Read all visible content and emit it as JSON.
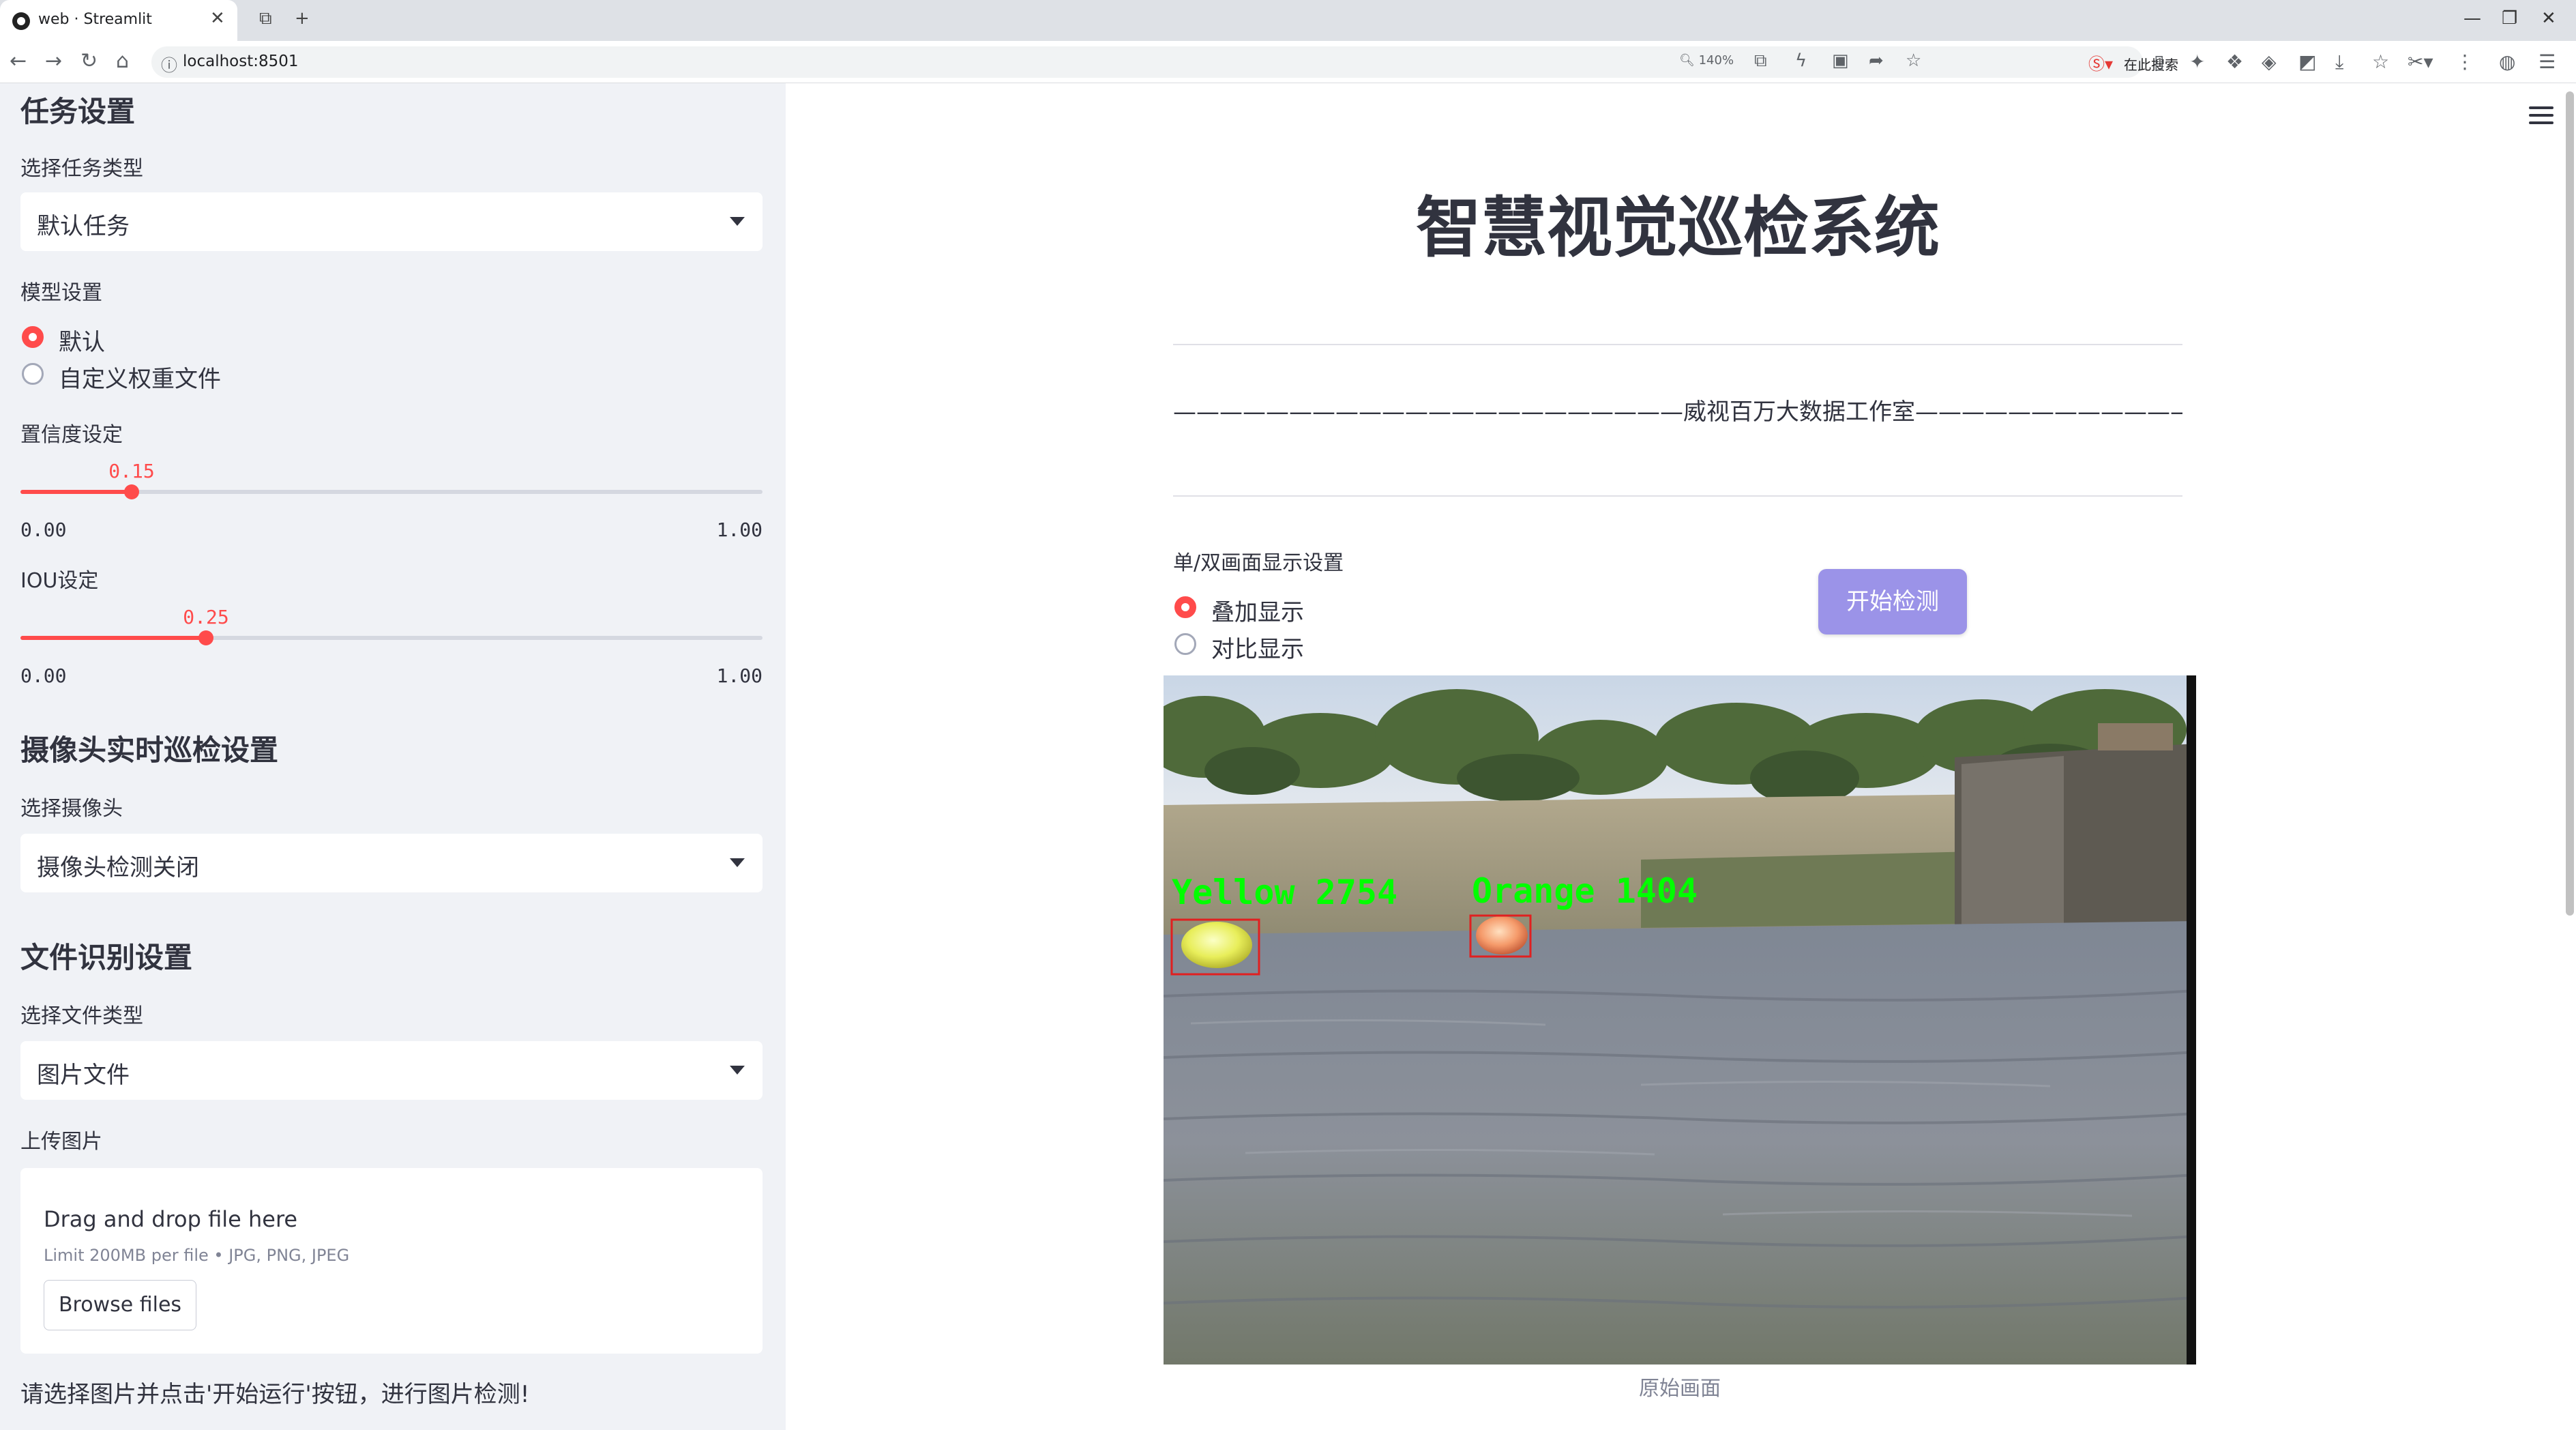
{
  "browser": {
    "tab_title": "web · Streamlit",
    "url": "localhost:8501",
    "zoom": "140%",
    "search_text": "在此搜索"
  },
  "sidebar": {
    "task_heading": "任务设置",
    "task_type_label": "选择任务类型",
    "task_type_value": "默认任务",
    "model_label": "模型设置",
    "model_options": [
      "默认",
      "自定义权重文件"
    ],
    "conf_label": "置信度设定",
    "conf": {
      "value": 0.15,
      "value_text": "0.15",
      "min": "0.00",
      "max": "1.00"
    },
    "iou_label": "IOU设定",
    "iou": {
      "value": 0.25,
      "value_text": "0.25",
      "min": "0.00",
      "max": "1.00"
    },
    "camera_heading": "摄像头实时巡检设置",
    "camera_label": "选择摄像头",
    "camera_value": "摄像头检测关闭",
    "file_heading": "文件识别设置",
    "file_type_label": "选择文件类型",
    "file_type_value": "图片文件",
    "upload_label": "上传图片",
    "upload_drop": "Drag and drop file here",
    "upload_limit": "Limit 200MB per file • JPG, PNG, JPEG",
    "upload_button": "Browse files",
    "hint": "请选择图片并点击'开始运行'按钮，进行图片检测!"
  },
  "main": {
    "title": "智慧视觉巡检系统",
    "subtitle": "——————————————————————威视百万大数据工作室———————————————————————",
    "display_label": "单/双画面显示设置",
    "display_options": [
      "叠加显示",
      "对比显示"
    ],
    "start_button": "开始检测",
    "caption": "原始画面",
    "detections": [
      {
        "label": "Yellow 2754"
      },
      {
        "label": "Orange 1404"
      }
    ]
  },
  "colors": {
    "accent": "#ff4b4b",
    "button": "#9b93e8",
    "sidebar_bg": "#f0f2f6",
    "detect_text": "#00ff00",
    "detect_box": "#e02020"
  }
}
